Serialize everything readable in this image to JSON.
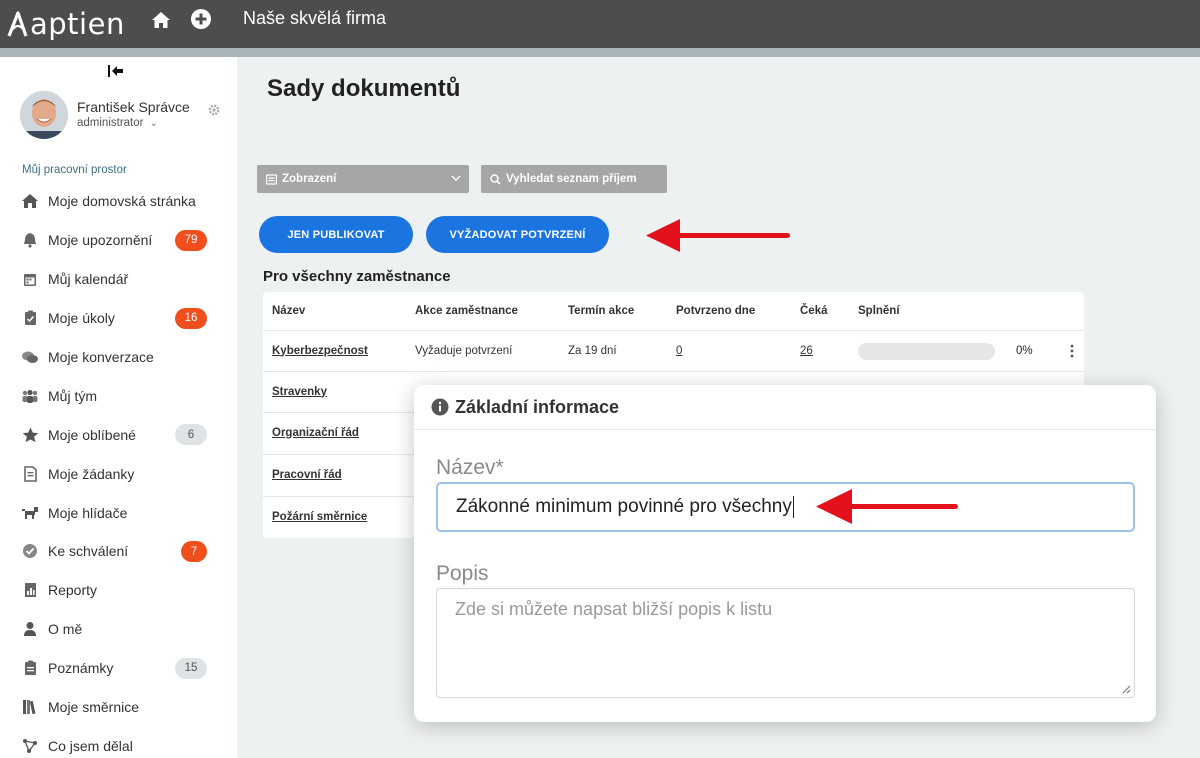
{
  "app": {
    "logo_text": "aptien",
    "company": "Naše skvělá firma"
  },
  "user": {
    "name": "František Správce",
    "role": "administrator"
  },
  "sidebar": {
    "section_title": "Můj pracovní prostor",
    "items": [
      {
        "label": "Moje domovská stránka",
        "icon": "house-icon"
      },
      {
        "label": "Moje upozornění",
        "icon": "bell-icon",
        "badge": "79",
        "badge_style": "red"
      },
      {
        "label": "Můj kalendář",
        "icon": "calendar-icon"
      },
      {
        "label": "Moje úkoly",
        "icon": "clipboard-icon",
        "badge": "16",
        "badge_style": "red"
      },
      {
        "label": "Moje konverzace",
        "icon": "chat-icon"
      },
      {
        "label": "Můj tým",
        "icon": "team-icon"
      },
      {
        "label": "Moje oblíbené",
        "icon": "star-icon",
        "badge": "6",
        "badge_style": "grey"
      },
      {
        "label": "Moje žádanky",
        "icon": "request-icon"
      },
      {
        "label": "Moje hlídače",
        "icon": "dog-icon"
      },
      {
        "label": "Ke schválení",
        "icon": "check-circle-icon",
        "badge": "7",
        "badge_style": "red"
      },
      {
        "label": "Reporty",
        "icon": "report-icon"
      },
      {
        "label": "O mě",
        "icon": "person-icon"
      },
      {
        "label": "Poznámky",
        "icon": "notes-icon",
        "badge": "15",
        "badge_style": "grey"
      },
      {
        "label": "Moje směrnice",
        "icon": "books-icon"
      },
      {
        "label": "Co jsem dělal",
        "icon": "activity-icon"
      }
    ]
  },
  "main": {
    "title": "Sady dokumentů",
    "view_select": "Zobrazení",
    "search_label": "Vyhledat seznam příjem",
    "btn_publish": "JEN PUBLIKOVAT",
    "btn_confirm": "VYŽADOVAT POTVRZENÍ",
    "section": "Pro všechny zaměstnance",
    "columns": [
      "Název",
      "Akce zaměstnance",
      "Termín akce",
      "Potvrzeno dne",
      "Čeká",
      "Splnění"
    ],
    "rows": [
      {
        "name": "Kyberbezpečnost",
        "action": "Vyžaduje potvrzení",
        "deadline": "Za 19 dní",
        "confirmed": "0",
        "waiting": "26",
        "progress": 0,
        "progress_label": "0%"
      },
      {
        "name": "Stravenky"
      },
      {
        "name": "Organizační řád"
      },
      {
        "name": "Pracovní řád"
      },
      {
        "name": "Požární směrnice"
      }
    ]
  },
  "modal": {
    "title": "Základní informace",
    "name_label": "Název*",
    "name_value": "Zákonné minimum povinné pro všechny",
    "desc_label": "Popis",
    "desc_placeholder": "Zde si můžete napsat bližší popis k listu"
  },
  "colors": {
    "topbar": "#4d4d4d",
    "accent_blue": "#1b75e0",
    "badge_red": "#f04e1c",
    "arrow_red": "#e3111b"
  }
}
